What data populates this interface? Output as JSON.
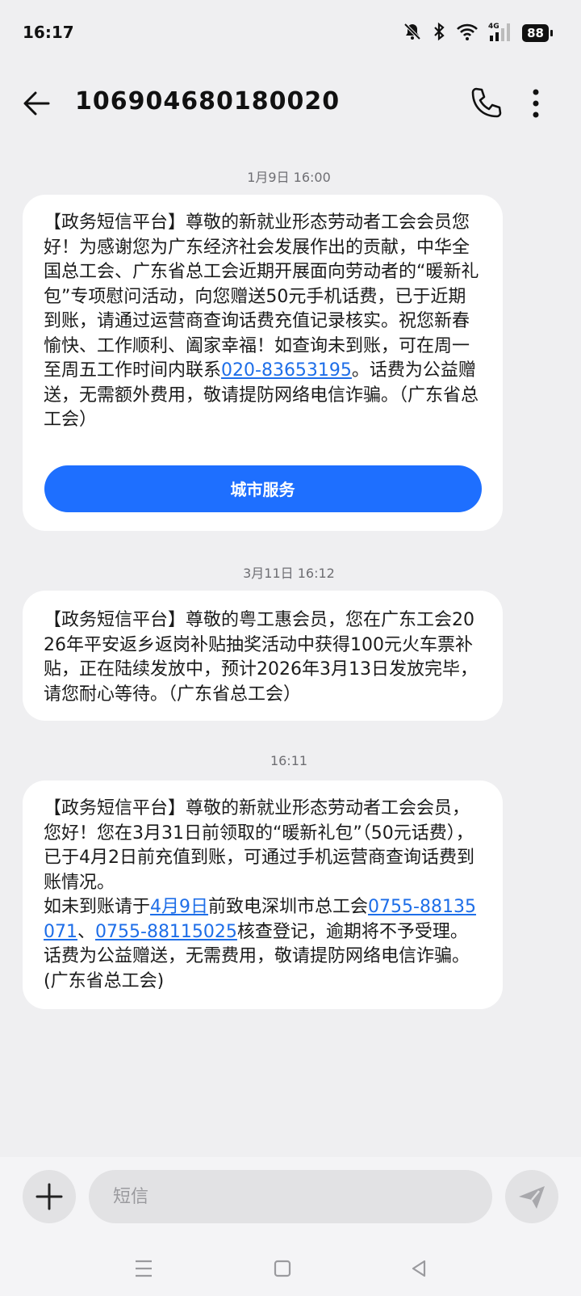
{
  "status_bar": {
    "time": "16:17",
    "battery": "88",
    "network": "4G"
  },
  "header": {
    "contact": "106904680180020"
  },
  "messages": [
    {
      "timestamp": "1月9日 16:00",
      "part1": "【政务短信平台】尊敬的新就业形态劳动者工会会员您好！为感谢您为广东经济社会发展作出的贡献，中华全国总工会、广东省总工会近期开展面向劳动者的“暖新礼包”专项慰问活动，向您赠送50元手机话费，已于近期到账，请通过运营商查询话费充值记录核实。祝您新春愉快、工作顺利、阖家幸福！如查询未到账，可在周一至周五工作时间内联系",
      "link_phone": "020-83653195",
      "part2": "。话费为公益赠送，无需额外费用，敬请提防网络电信诈骗。（广东省总工会）",
      "button_label": "城市服务"
    },
    {
      "timestamp": "3月11日 16:12",
      "text": "【政务短信平台】尊敬的粤工惠会员，您在广东工会2026年平安返乡返岗补贴抽奖活动中获得100元火车票补贴，正在陆续发放中，预计2026年3月13日发放完毕，请您耐心等待。（广东省总工会）"
    },
    {
      "timestamp": "16:11",
      "part1": "【政务短信平台】尊敬的新就业形态劳动者工会会员，您好！您在3月31日前领取的“暖新礼包”（50元话费），已于4月2日前充值到账，可通过手机运营商查询话费到账情况。",
      "part2": "如未到账请于",
      "link_date": "4月9日",
      "part3": "前致电深圳市总工会",
      "link_phone1": "0755-88135071",
      "sep": "、",
      "link_phone2": "0755-88115025",
      "part4": "核查登记，逾期将不予受理。话费为公益赠送，无需费用，敬请提防网络电信诈骗。(广东省总工会)"
    }
  ],
  "composer": {
    "placeholder": "短信"
  }
}
